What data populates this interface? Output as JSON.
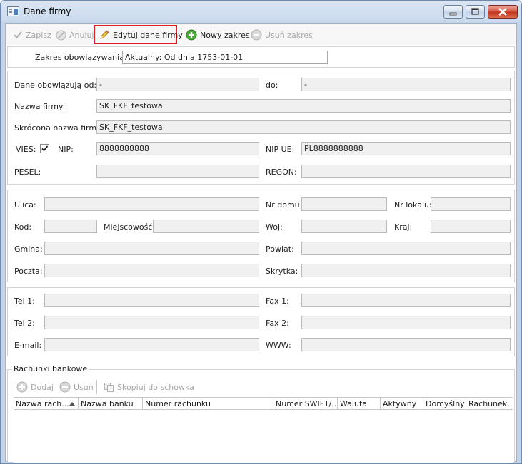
{
  "window": {
    "title": "Dane firmy"
  },
  "toolbar": {
    "save": "Zapisz",
    "cancel": "Anuluj",
    "edit": "Edytuj dane firmy",
    "new_range": "Nowy zakres",
    "delete_range": "Usuń zakres"
  },
  "scope": {
    "label": "Zakres obowiązywania",
    "value": "Aktualny: Od dnia 1753-01-01"
  },
  "company": {
    "valid_from_label": "Dane obowiązują od:",
    "valid_from": "-",
    "valid_to_label": "do:",
    "valid_to": "-",
    "name_label": "Nazwa firmy:",
    "name": "SK_FKF_testowa",
    "short_name_label": "Skrócona nazwa firmy:",
    "short_name": "SK_FKF_testowa",
    "vies_label": "VIES:",
    "vies_checked": true,
    "nip_label": "NIP:",
    "nip": "8888888888",
    "nip_ue_label": "NIP UE:",
    "nip_ue": "PL8888888888",
    "pesel_label": "PESEL:",
    "pesel": "",
    "regon_label": "REGON:",
    "regon": ""
  },
  "address": {
    "street_label": "Ulica:",
    "street": "",
    "house_label": "Nr domu:",
    "house": "",
    "apt_label": "Nr lokalu:",
    "apt": "",
    "code_label": "Kod:",
    "code": "",
    "city_label": "Miejscowość:",
    "city": "",
    "province_label": "Woj:",
    "province": "",
    "country_label": "Kraj:",
    "country": "",
    "commune_label": "Gmina:",
    "commune": "",
    "county_label": "Powiat:",
    "county": "",
    "post_label": "Poczta:",
    "post": "",
    "pobox_label": "Skrytka:",
    "pobox": ""
  },
  "contact": {
    "tel1_label": "Tel 1:",
    "tel1": "",
    "fax1_label": "Fax 1:",
    "fax1": "",
    "tel2_label": "Tel 2:",
    "tel2": "",
    "fax2_label": "Fax 2:",
    "fax2": "",
    "email_label": "E-mail:",
    "email": "",
    "www_label": "WWW:",
    "www": ""
  },
  "bank": {
    "title": "Rachunki bankowe",
    "add": "Dodaj",
    "remove": "Usuń",
    "copy": "Skopiuj do schowka",
    "columns": [
      "Nazwa rach...",
      "Nazwa banku",
      "Numer rachunku",
      "Numer SWIFT/...",
      "Waluta",
      "Aktywny",
      "Domyślny",
      "Rachunek..."
    ]
  },
  "colors": {
    "highlight": "#e01c24",
    "field_bg": "#f0f0f0",
    "title_bar": "#c9d9ed"
  }
}
